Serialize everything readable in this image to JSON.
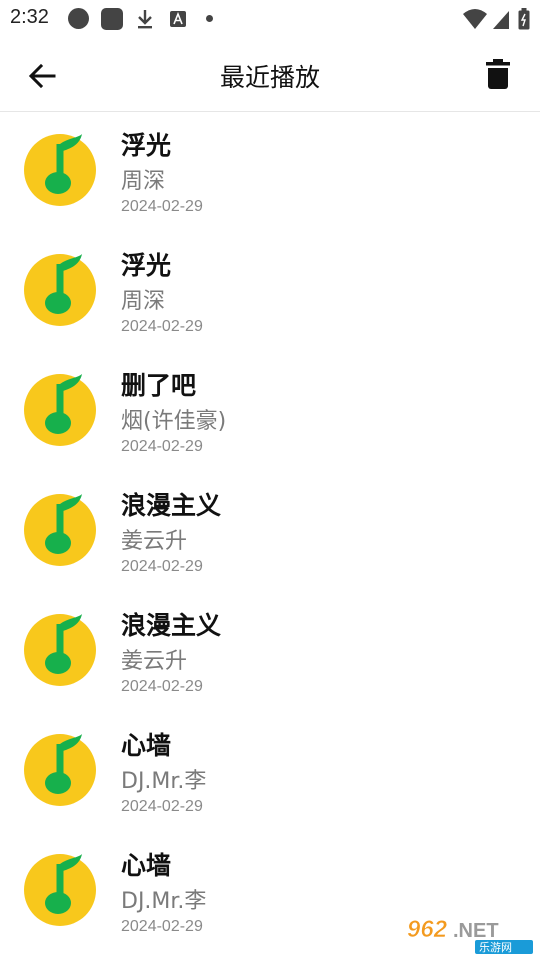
{
  "status_bar": {
    "time": "2:32",
    "icons": [
      "circle-icon",
      "square-icon",
      "download-icon",
      "a-icon",
      "dot-icon",
      "wifi-icon",
      "signal-icon",
      "battery-icon"
    ]
  },
  "app_bar": {
    "title": "最近播放",
    "back_icon": "back-arrow-icon",
    "delete_icon": "trash-icon"
  },
  "songs": [
    {
      "title": "浮光",
      "artist": "周深",
      "date": "2024-02-29"
    },
    {
      "title": "浮光",
      "artist": "周深",
      "date": "2024-02-29"
    },
    {
      "title": "删了吧",
      "artist": "烟(许佳豪)",
      "date": "2024-02-29"
    },
    {
      "title": "浪漫主义",
      "artist": "姜云升",
      "date": "2024-02-29"
    },
    {
      "title": "浪漫主义",
      "artist": "姜云升",
      "date": "2024-02-29"
    },
    {
      "title": "心墙",
      "artist": "DJ.Mr.李",
      "date": "2024-02-29"
    },
    {
      "title": "心墙",
      "artist": "DJ.Mr.李",
      "date": "2024-02-29"
    }
  ],
  "colors": {
    "cover_yellow": "#f8c81c",
    "cover_green": "#17b04c",
    "watermark_orange": "#f39a1e"
  },
  "watermark": {
    "main": "962.NET",
    "sub": "乐游网"
  }
}
